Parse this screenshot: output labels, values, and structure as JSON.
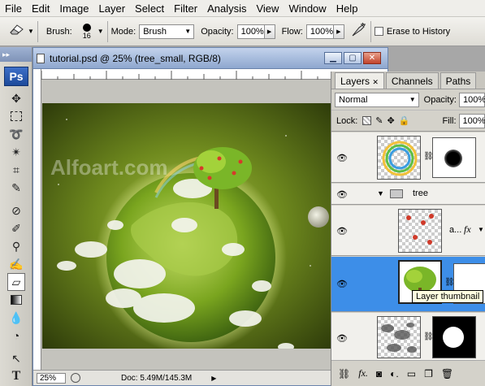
{
  "menu": [
    "File",
    "Edit",
    "Image",
    "Layer",
    "Select",
    "Filter",
    "Analysis",
    "View",
    "Window",
    "Help"
  ],
  "options": {
    "brush_label": "Brush:",
    "brush_size": "16",
    "mode_label": "Mode:",
    "mode_value": "Brush",
    "opacity_label": "Opacity:",
    "opacity_value": "100%",
    "flow_label": "Flow:",
    "flow_value": "100%",
    "erase_history_label": "Erase to History"
  },
  "toolbox": {
    "logo": "Ps"
  },
  "document": {
    "title": "tutorial.psd @ 25% (tree_small, RGB/8)",
    "watermark": "Alfoart.com",
    "zoom": "25%",
    "doc_info": "Doc: 5.49M/145.3M"
  },
  "layers_panel": {
    "tabs": [
      "Layers",
      "Channels",
      "Paths"
    ],
    "blend_mode": "Normal",
    "opacity_label": "Opacity:",
    "opacity_value": "100%",
    "lock_label": "Lock:",
    "fill_label": "Fill:",
    "fill_value": "100%",
    "group_name": "tree",
    "layer_ellipsis": "a...",
    "tooltip": "Layer thumbnail"
  },
  "colors": {
    "selection": "#3d8ee8",
    "canvas_green": "#6f8a1e"
  }
}
